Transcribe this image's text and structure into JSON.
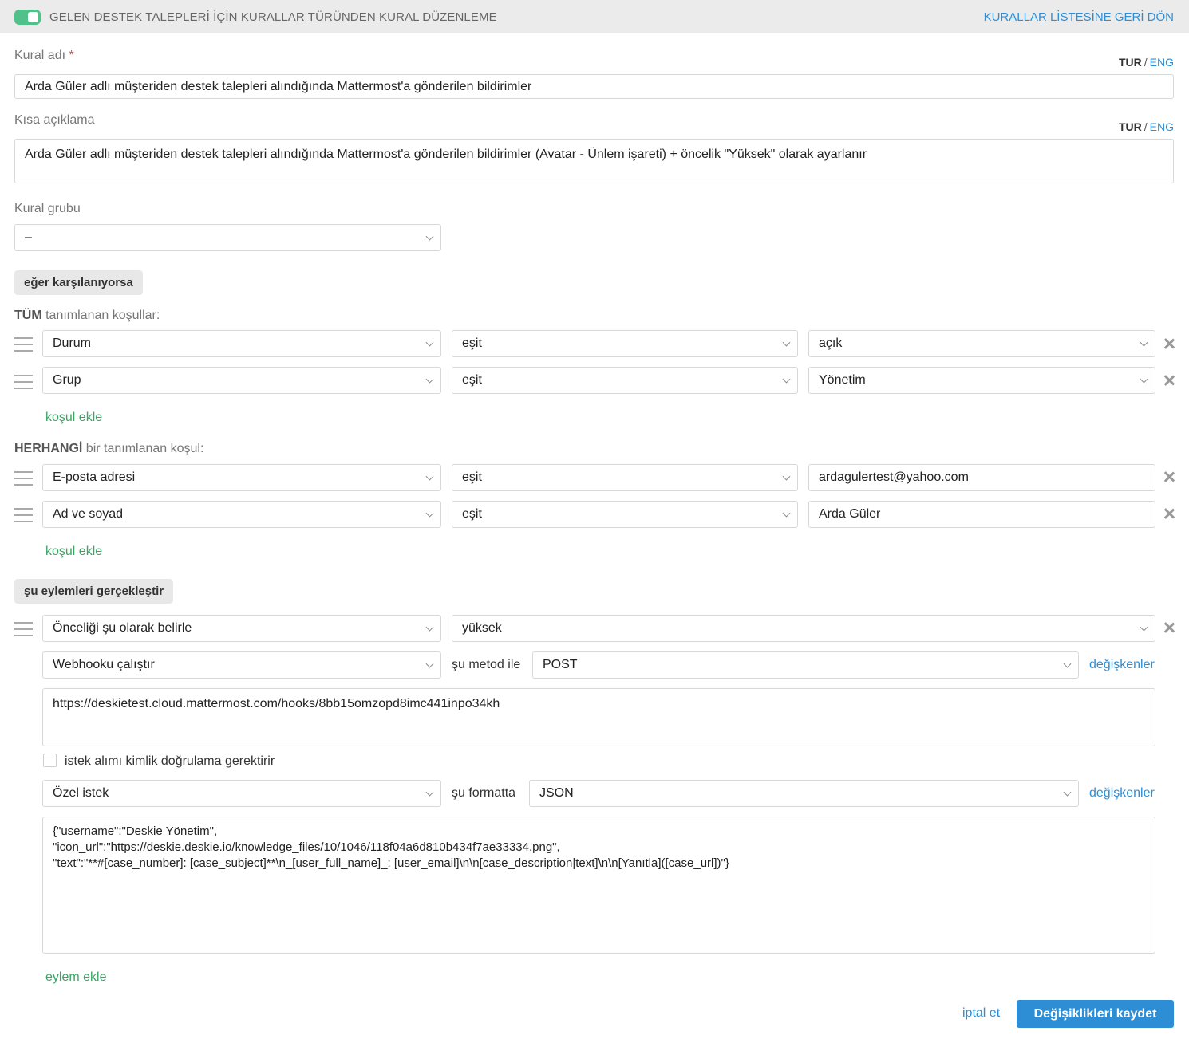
{
  "header": {
    "title": "GELEN DESTEK TALEPLERİ İÇİN KURALLAR TÜRÜNDEN KURAL DÜZENLEME",
    "back_link": "KURALLAR LİSTESİNE GERİ DÖN",
    "accent": "#52c08a"
  },
  "lang": {
    "tur": "TUR",
    "sep": "/",
    "eng": "ENG"
  },
  "rule_name": {
    "label": "Kural adı",
    "required_mark": "*",
    "value": "Arda Güler adlı müşteriden destek talepleri alındığında Mattermost'a gönderilen bildirimler"
  },
  "short_desc": {
    "label": "Kısa açıklama",
    "value": "Arda Güler adlı müşteriden destek talepleri alındığında Mattermost'a gönderilen bildirimler (Avatar - Ünlem işareti) + öncelik \"Yüksek\" olarak ayarlanır"
  },
  "rule_group": {
    "label": "Kural grubu",
    "value": "–"
  },
  "if_chip": "eğer karşılanıyorsa",
  "all_conditions": {
    "title_bold": "TÜM",
    "title_rest": "tanımlanan koşullar:",
    "rows": [
      {
        "field": "Durum",
        "operator": "eşit",
        "value": "açık"
      },
      {
        "field": "Grup",
        "operator": "eşit",
        "value": "Yönetim"
      }
    ],
    "add_label": "koşul ekle"
  },
  "any_conditions": {
    "title_bold": "HERHANGİ",
    "title_rest": "bir tanımlanan koşul:",
    "rows": [
      {
        "field": "E-posta adresi",
        "operator": "eşit",
        "value": "ardagulertest@yahoo.com"
      },
      {
        "field": "Ad ve soyad",
        "operator": "eşit",
        "value": "Arda Güler"
      }
    ],
    "add_label": "koşul ekle"
  },
  "actions_chip": "şu eylemleri gerçekleştir",
  "actions": {
    "priority": {
      "action": "Önceliği şu olarak belirle",
      "value": "yüksek"
    },
    "webhook": {
      "action": "Webhooku çalıştır",
      "method_label": "şu metod ile",
      "method": "POST",
      "variables_label": "değişkenler",
      "url": "https://deskietest.cloud.mattermost.com/hooks/8bb15omzopd8imc441inpo34kh",
      "auth_label": "istek alımı kimlik doğrulama gerektirir"
    },
    "request": {
      "type": "Özel istek",
      "format_label": "şu formatta",
      "format": "JSON",
      "variables_label": "değişkenler",
      "body": "{\"username\":\"Deskie Yönetim\",\n\"icon_url\":\"https://deskie.deskie.io/knowledge_files/10/1046/118f04a6d810b434f7ae33334.png\",\n\"text\":\"**#[case_number]: [case_subject]**\\n_[user_full_name]_: [user_email]\\n\\n[case_description|text]\\n\\n[Yanıtla]([case_url])\"}"
    },
    "add_label": "eylem ekle"
  },
  "footer": {
    "cancel": "iptal et",
    "save": "Değişiklikleri kaydet"
  }
}
